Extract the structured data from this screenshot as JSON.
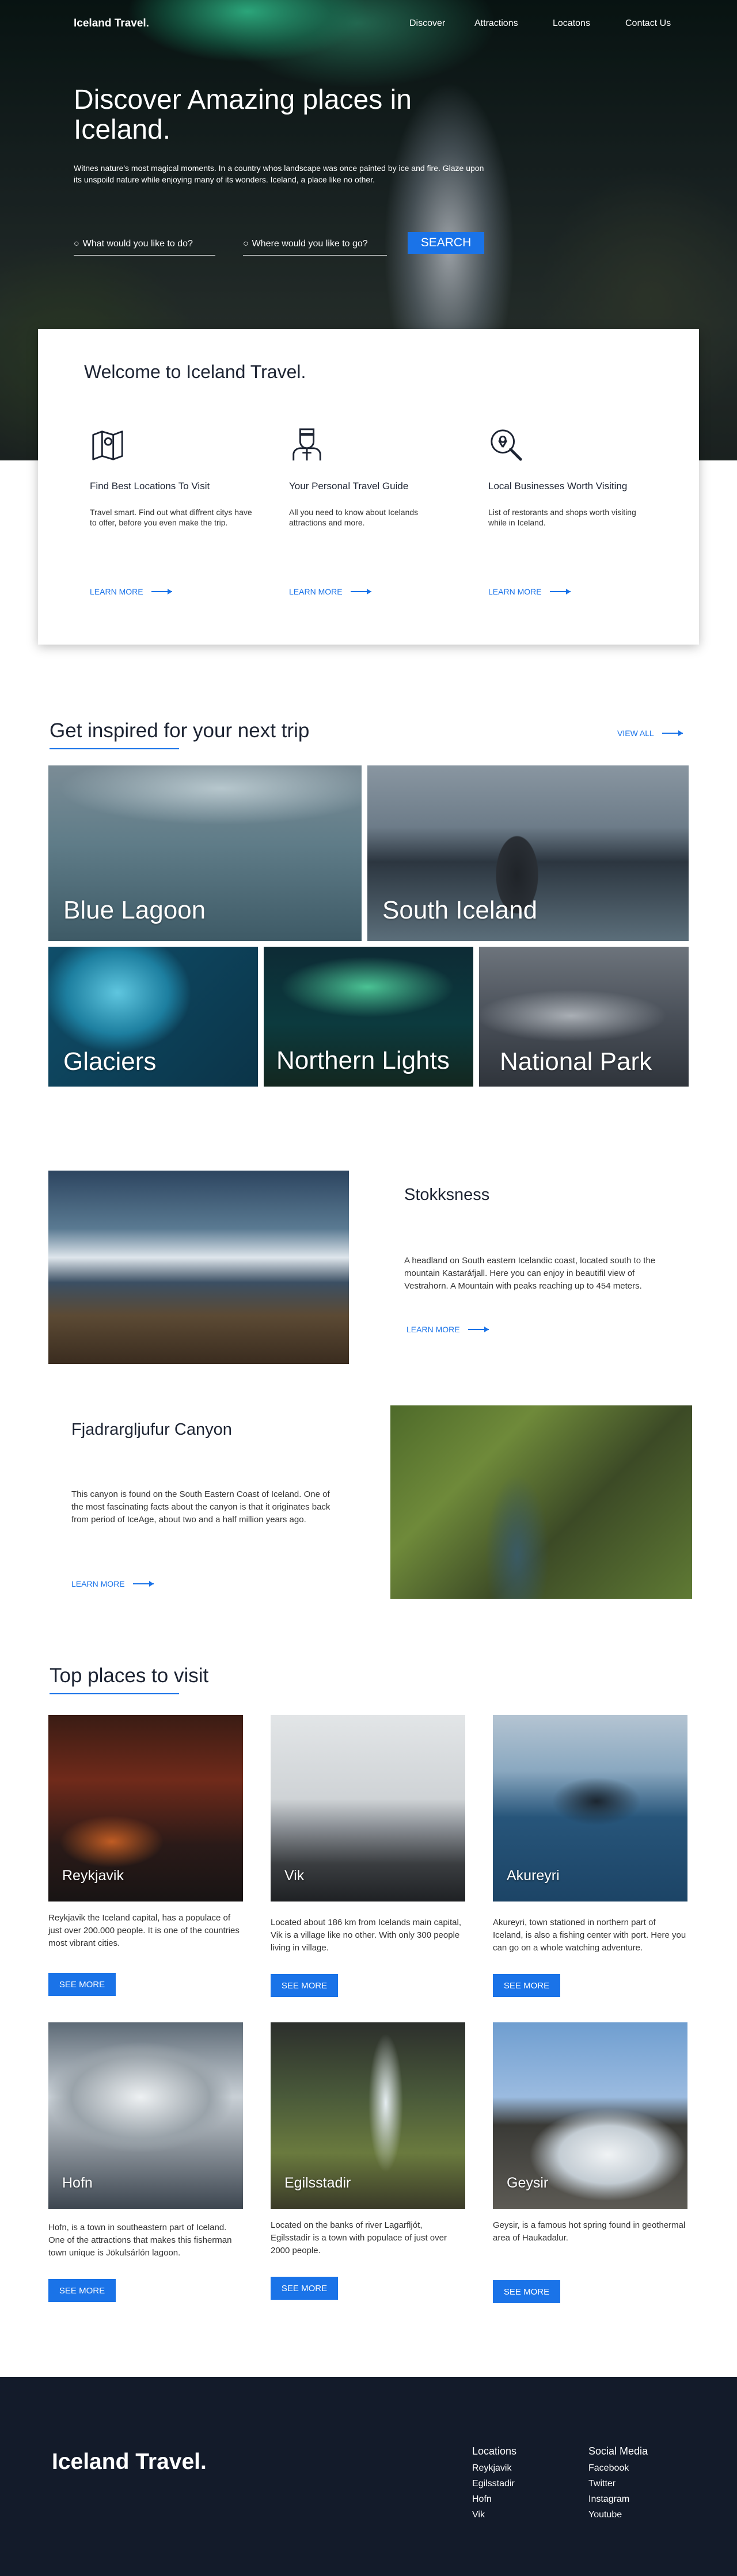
{
  "header": {
    "logo": "Iceland Travel.",
    "nav": [
      "Discover",
      "Attractions",
      "Locatons",
      "Contact Us"
    ]
  },
  "hero": {
    "title": "Discover Amazing places in Iceland.",
    "subtitle": "Witnes nature's most magical moments. In a country whos landscape was once painted by ice and fire. Glaze upon its unspoild nature while enjoying many of its wonders. Iceland, a place like no other.",
    "search_what_placeholder": "What would you like to do?",
    "search_where_placeholder": "Where would you like to go?",
    "search_button": "SEARCH"
  },
  "welcome": {
    "title": "Welcome to Iceland Travel.",
    "features": [
      {
        "icon": "map-icon",
        "title": "Find Best Locations To Visit",
        "text": "Travel smart. Find out what diffrent citys have to offer, before you even make the trip.",
        "link": "LEARN MORE"
      },
      {
        "icon": "guide-icon",
        "title": "Your Personal Travel Guide",
        "text": "All you need to know about Icelands attractions and more.",
        "link": "LEARN MORE"
      },
      {
        "icon": "magnifier-icon",
        "title": "Local Businesses Worth Visiting",
        "text": "List of restorants and shops worth visiting while in Iceland.",
        "link": "LEARN MORE"
      }
    ]
  },
  "inspired": {
    "title": "Get inspired for your next trip",
    "view_all": "VIEW ALL",
    "tiles": [
      "Blue Lagoon",
      "South Iceland",
      "Glaciers",
      "Northern Lights",
      "National Park"
    ]
  },
  "spots": [
    {
      "title": "Stokksness",
      "text": "A headland on South eastern Icelandic coast, located south to the mountain Kastaráfjall. Here you can enjoy in beautifil view of Vestrahorn. A Mountain with peaks reaching up to 454 meters.",
      "link": "LEARN MORE"
    },
    {
      "title": "Fjadrargljufur Canyon",
      "text": "This canyon is found on the South Eastern Coast of Iceland. One of the most fascinating facts about the canyon is that it originates back from period of IceAge, about two and a half million years ago.",
      "link": "LEARN MORE"
    }
  ],
  "top_places": {
    "title": "Top places to visit",
    "places": [
      {
        "name": "Reykjavik",
        "text": "Reykjavik the Iceland capital, has a populace of just over 200.000 people.  It is one of the countries most vibrant cities.",
        "button": "SEE MORE"
      },
      {
        "name": "Vik",
        "text": "Located about 186 km from Icelands main capital, Vik is a village like no other. With only 300 people living in village.",
        "button": "SEE MORE"
      },
      {
        "name": "Akureyri",
        "text": "Akureyri, town stationed in northern part of Iceland, is also a fishing center with port. Here you can go on a whole watching adventure.",
        "button": "SEE MORE"
      },
      {
        "name": "Hofn",
        "text": "Hofn, is a town in southeastern part of Iceland. One of the attractions that makes this fisherman town unique is Jökulsárlón lagoon.",
        "button": "SEE MORE"
      },
      {
        "name": "Egilsstadir",
        "text": "Located on the banks of river Lagarfljót, Egilsstadir is a town with populace of just over 2000 people.",
        "button": "SEE MORE"
      },
      {
        "name": "Geysir",
        "text": "Geysir, is a famous hot spring found in geothermal area of Haukadalur.",
        "button": "SEE MORE"
      }
    ]
  },
  "footer": {
    "logo": "Iceland Travel.",
    "locations_title": "Locations",
    "locations": [
      "Reykjavik",
      "Egilsstadir",
      "Hofn",
      "Vik"
    ],
    "social_title": "Social Media",
    "social": [
      "Facebook",
      "Twitter",
      "Instagram",
      "Youtube"
    ]
  },
  "colors": {
    "accent": "#1a73e8",
    "footer_bg": "#131b2a",
    "text": "#1d2433"
  }
}
